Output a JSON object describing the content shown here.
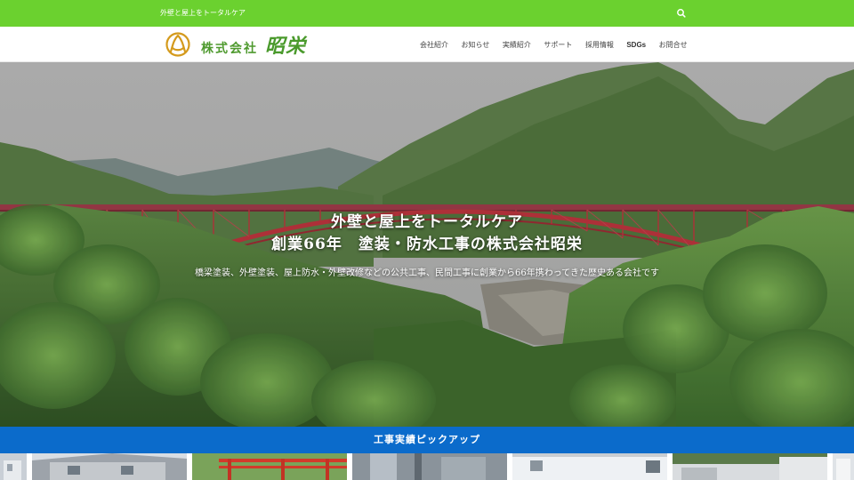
{
  "topbar": {
    "tagline": "外壁と屋上をトータルケア",
    "search_icon": "search-icon"
  },
  "header": {
    "logo_prefix": "株式会社",
    "logo_name": "昭栄",
    "nav": [
      {
        "label": "会社紹介"
      },
      {
        "label": "お知らせ"
      },
      {
        "label": "実績紹介"
      },
      {
        "label": "サポート"
      },
      {
        "label": "採用情報"
      },
      {
        "label": "SDGs"
      },
      {
        "label": "お問合せ"
      }
    ]
  },
  "hero": {
    "line1": "外壁と屋上をトータルケア",
    "line2": "創業66年　塗装・防水工事の株式会社昭栄",
    "description": "橋梁塗装、外壁塗装、屋上防水・外壁改修などの公共工事、民間工事に創業から66年携わってきた歴史ある会社です"
  },
  "pickup": {
    "title": "工事実績ピックアップ"
  },
  "colors": {
    "topbar": "#6bd12f",
    "brand_green": "#4f9a2f",
    "logo_gold": "#d49a1c",
    "pickup_blue": "#0b6bcb",
    "bridge_red": "#b8343c"
  }
}
